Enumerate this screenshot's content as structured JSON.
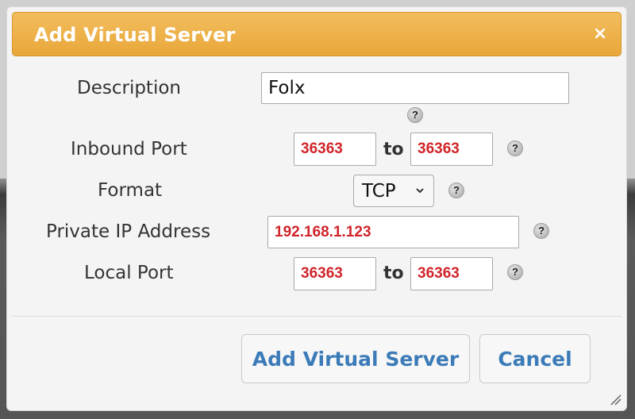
{
  "dialog": {
    "title": "Add Virtual Server",
    "close_glyph": "×"
  },
  "form": {
    "description": {
      "label": "Description",
      "value": "Folx"
    },
    "inbound_port": {
      "label": "Inbound Port",
      "from": "36363",
      "to_label": "to",
      "to": "36363"
    },
    "format": {
      "label": "Format",
      "selected": "TCP"
    },
    "private_ip": {
      "label": "Private IP Address",
      "value": "192.168.1.123"
    },
    "local_port": {
      "label": "Local Port",
      "from": "36363",
      "to_label": "to",
      "to": "36363"
    },
    "help_glyph": "?"
  },
  "buttons": {
    "add_label": "Add Virtual Server",
    "cancel_label": "Cancel"
  },
  "colors": {
    "title_bar": "#e9a73a",
    "value_red": "#d0252b",
    "button_text": "#3b7bb8"
  },
  "icons": {
    "help": "help-icon",
    "close": "close-icon",
    "select_arrow": "chevron-down-icon",
    "resize": "resize-grip-icon"
  }
}
